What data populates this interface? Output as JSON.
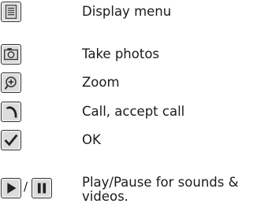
{
  "items": [
    {
      "icon": "menu-icon",
      "label": "Display menu"
    },
    {
      "icon": "camera-icon",
      "label": "Take photos"
    },
    {
      "icon": "zoom-icon",
      "label": "Zoom"
    },
    {
      "icon": "call-icon",
      "label": "Call, accept call"
    },
    {
      "icon": "checkmark-icon",
      "label": "OK"
    },
    {
      "icons": [
        "play-icon",
        "pause-icon"
      ],
      "separator": "/",
      "label": "Play/Pause for sounds & videos."
    }
  ]
}
